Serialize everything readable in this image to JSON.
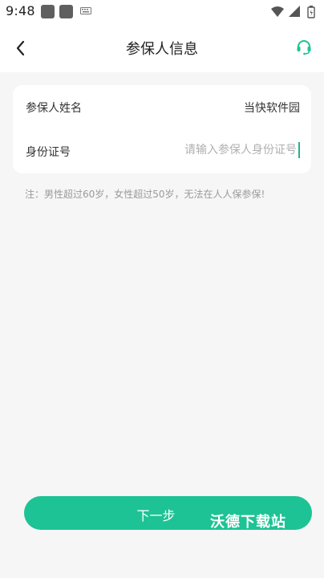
{
  "status_bar": {
    "time": "9:48",
    "icons": [
      "app-icon",
      "app-icon",
      "keyboard-icon",
      "wifi-icon",
      "signal-icon",
      "battery-icon"
    ]
  },
  "header": {
    "title": "参保人信息",
    "back_icon": "chevron-left-icon",
    "service_icon": "headset-icon"
  },
  "form": {
    "name_label": "参保人姓名",
    "name_value": "当快软件园",
    "id_label": "身份证号",
    "id_placeholder": "请输入参保人身份证号",
    "id_value": ""
  },
  "note": "注：男性超过60岁，女性超过50岁，无法在人人保参保!",
  "next_button": {
    "label": "下一步"
  },
  "watermark": "沃德下载站",
  "colors": {
    "accent": "#1dc394",
    "background": "#f6f6f6",
    "card": "#ffffff"
  }
}
